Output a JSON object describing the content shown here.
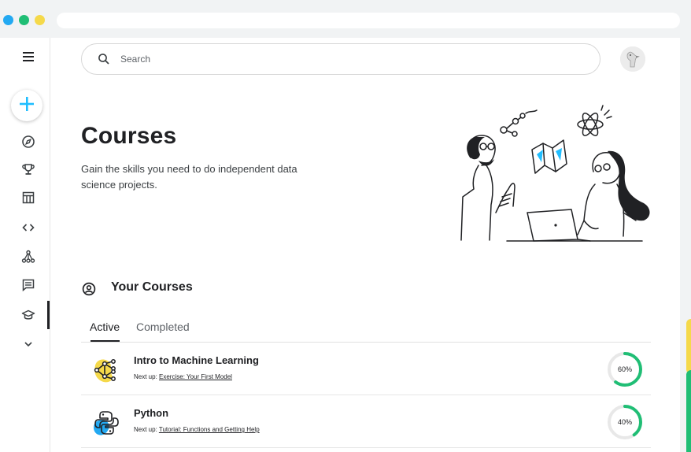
{
  "browser": {
    "dot_colors": [
      "#23a9f2",
      "#20be75",
      "#f5d94a"
    ]
  },
  "sidebar": {
    "items": [
      {
        "name": "menu",
        "icon": "menu-icon"
      },
      {
        "name": "create",
        "icon": "plus-icon"
      },
      {
        "name": "explore",
        "icon": "compass-icon"
      },
      {
        "name": "competitions",
        "icon": "trophy-icon"
      },
      {
        "name": "datasets",
        "icon": "table-icon"
      },
      {
        "name": "code",
        "icon": "code-icon"
      },
      {
        "name": "models",
        "icon": "models-icon"
      },
      {
        "name": "discussions",
        "icon": "discussion-icon"
      },
      {
        "name": "learn",
        "icon": "graduation-cap-icon",
        "active": true
      },
      {
        "name": "more",
        "icon": "chevron-down-icon"
      }
    ]
  },
  "header": {
    "search_placeholder": "Search"
  },
  "hero": {
    "title": "Courses",
    "subtitle": "Gain the skills you need to do independent data science projects."
  },
  "section": {
    "title": "Your Courses"
  },
  "tabs": [
    {
      "label": "Active",
      "active": true
    },
    {
      "label": "Completed",
      "active": false
    }
  ],
  "courses": [
    {
      "name": "Intro to Machine Learning",
      "next_prefix": "Next up: ",
      "next_link": "Exercise: Your First Model",
      "progress_label": "60%",
      "progress": 0.6,
      "logo_color": "#f5d94a"
    },
    {
      "name": "Python",
      "next_prefix": "Next up: ",
      "next_link": "Tutorial: Functions and Getting Help",
      "progress_label": "40%",
      "progress": 0.4,
      "logo_color": "#23a9f2"
    }
  ],
  "colors": {
    "progress_fill": "#20be75",
    "progress_track": "#e8e8e8",
    "accent_blue": "#20beff"
  }
}
